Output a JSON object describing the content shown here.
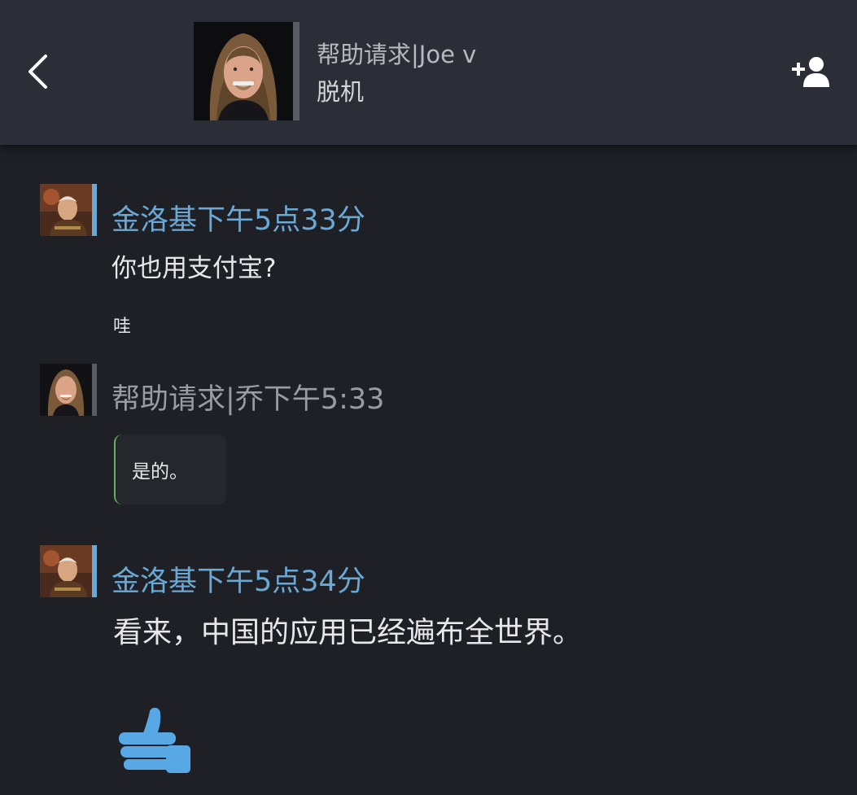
{
  "header": {
    "back_icon": "chevron-left-icon",
    "contact_name": "帮助请求|Joe v",
    "contact_status": "脱机",
    "add_friend_icon": "add-friend-icon"
  },
  "messages": [
    {
      "sender": "金洛基",
      "time": "下午5点33分",
      "lines": [
        "你也用支付宝?",
        "哇"
      ]
    },
    {
      "sender": "帮助请求|乔",
      "time": "下午5:33",
      "bubble": "是的。"
    },
    {
      "sender": "金洛基",
      "time": "下午5点34分",
      "lines": [
        "看来，中国的应用已经遍布全世界。"
      ],
      "reaction_icon": "thumbs-up-icon"
    }
  ],
  "colors": {
    "header_bg": "#2b2e36",
    "chat_bg": "#1f2026",
    "accent_blue": "#6aa9d6",
    "friend_gray": "#9a9ca1",
    "bubble_border": "#5fb55a",
    "thumb_blue": "#58a8e6"
  }
}
